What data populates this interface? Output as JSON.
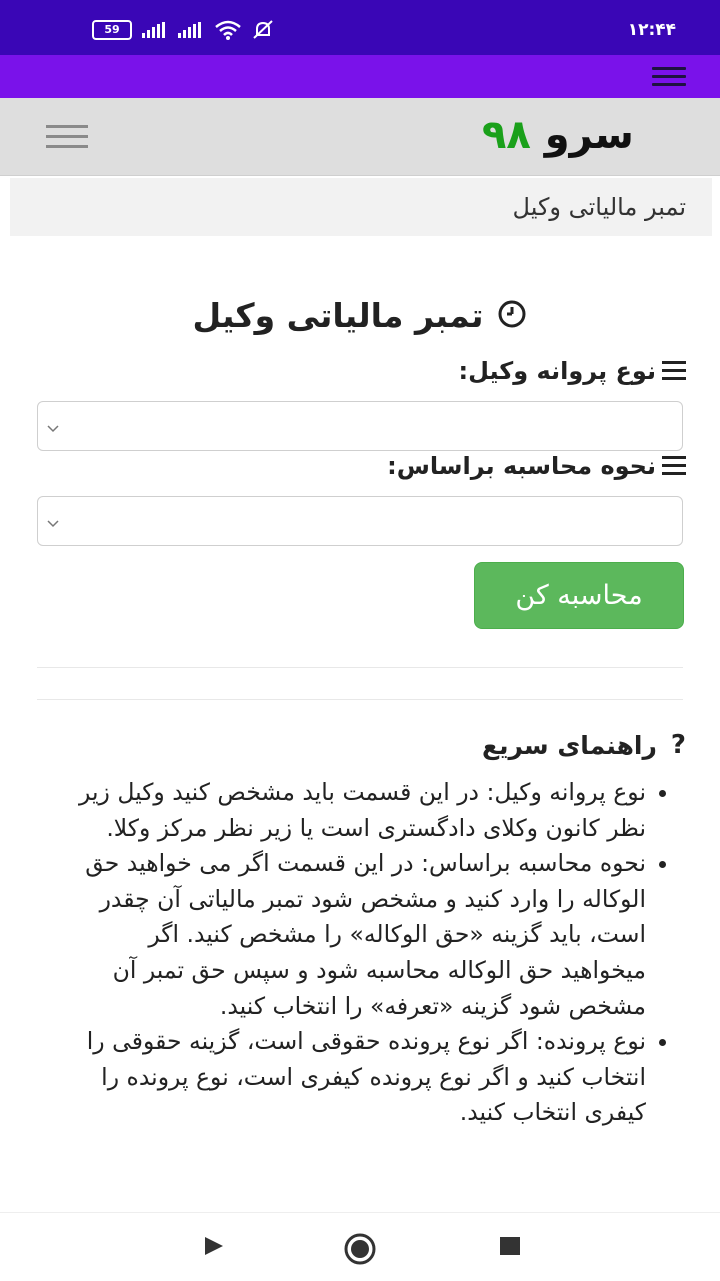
{
  "status_bar": {
    "battery": "59",
    "time": "۱۲:۴۴"
  },
  "header": {
    "logo_word": "سرو",
    "logo_number": "۹۸"
  },
  "breadcrumb": {
    "text": "تمبر مالیاتی وکیل"
  },
  "form": {
    "title": "تمبر مالیاتی وکیل",
    "license_label": "نوع پروانه وکیل:",
    "license_value": "",
    "calc_basis_label": "نحوه محاسبه براساس:",
    "calc_basis_value": "",
    "submit_label": "محاسبه کن"
  },
  "guide": {
    "title": "راهنمای سریع",
    "items": [
      "نوع پروانه وکیل: در این قسمت باید مشخص کنید وکیل زیر نظر کانون وکلای دادگستری است یا زیر نظر مرکز وکلا.",
      "نحوه محاسبه براساس: در این قسمت اگر می خواهید حق الوکاله را وارد کنید و مشخص شود تمبر مالیاتی آن چقدر است، باید گزینه «حق الوکاله» را مشخص کنید. اگر میخواهید حق الوکاله محاسبه شود و سپس حق تمبر آن مشخص شود گزینه «تعرفه» را انتخاب کنید.",
      "نوع پرونده: اگر نوع پرونده حقوقی است، گزینه حقوقی را انتخاب کنید و اگر نوع پرونده کیفری است، نوع پرونده را کیفری انتخاب کنید."
    ]
  },
  "colors": {
    "status_bar": "#3a06b6",
    "app_bar": "#7a12ea",
    "logo_number": "#1aa01a",
    "submit_button": "#5cb85c"
  },
  "icons": {
    "clock": "clock-icon",
    "question": "question-icon",
    "menu": "hamburger-icon"
  }
}
